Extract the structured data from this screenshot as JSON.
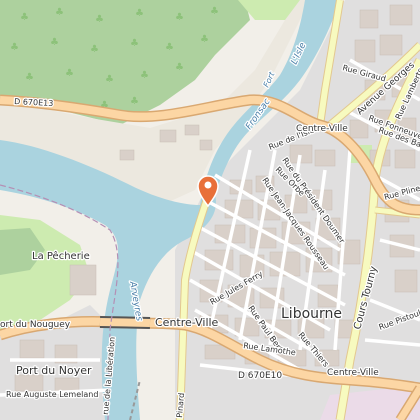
{
  "map": {
    "place_labels": {
      "libourne": "Libourne",
      "la_pecherie": "La Pêcherie",
      "port_du_noyer": "Port du Noyer",
      "port_du_nouguey": "ort du Nouguey",
      "centre_ville_1": "Centre-Ville",
      "centre_ville_2": "Centre-Ville",
      "centre_ville_3": "Centre-Ville"
    },
    "water_labels": {
      "isle": "L'Isle",
      "fronsac": "Fronsac",
      "fort": "Fort",
      "arveyres": "Arveyres"
    },
    "road_labels": {
      "d670e13": "D 670E13",
      "d670e10": "D 670E10",
      "rue_giraud": "Rue Giraud",
      "avenue_georges": "Avenue Georges",
      "rue_lamberts": "Rue Lamberts",
      "rue_fonneuve": "Rue Fonneuve",
      "rue_des_barras": "Rue des Barras",
      "rue_de_lisle": "Rue de l'Isle",
      "rue_orbe": "Rue Orbe",
      "rue_du_president_doumer": "Rue du Président Doumer",
      "rue_jean_jacques_rousseau": "Rue Jean-Jacques Rousseau",
      "rue_pline_parmentier": "Rue Pline P",
      "cours_tourny": "Cours Tourny",
      "rue_jules_ferry": "Rue Jules Ferry",
      "rue_paul_bert": "Rue Paul Bert",
      "rue_thiers": "Rue Thiers",
      "rue_lamothe": "Rue Lamothe",
      "rue_pistouley": "Rue Pistouley",
      "rue_auguste_lemeland": "Rue Auguste Lemeland",
      "rue_de_la_liberation": "rue de la Libération",
      "rue_pinard": "Pinard"
    },
    "marker": {
      "icon": "map-pin-icon",
      "color": "#e8703a"
    },
    "colors": {
      "water": "#aad3df",
      "forest": "#add19e",
      "grass": "#cdebb0",
      "urban": "#e0dfdf",
      "building": "#d9d0c9",
      "primary_road": "#fcd6a4",
      "secondary_road": "#f7fabf",
      "minor_road": "#ffffff",
      "industrial": "#ebdbe8"
    }
  }
}
